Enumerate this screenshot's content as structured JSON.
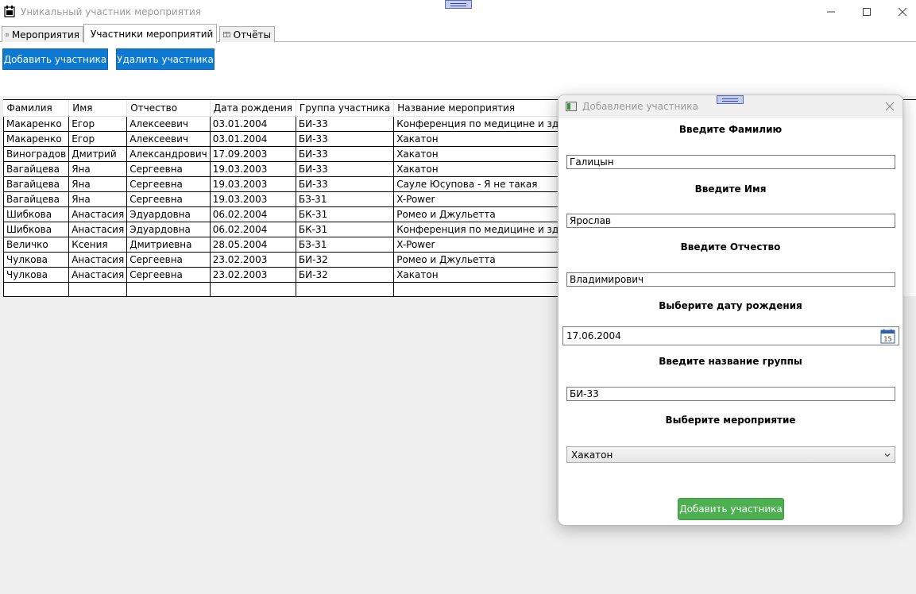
{
  "window": {
    "title": "Уникальный участник мероприятия"
  },
  "tabs": [
    {
      "label": "Мероприятия",
      "icon": "document-icon"
    },
    {
      "label": "Участники мероприятий",
      "icon": "users-icon",
      "active": true
    },
    {
      "label": "Отчёты",
      "icon": "book-icon"
    }
  ],
  "toolbar": {
    "add_label": "Добавить участника",
    "delete_label": "Удалить участника"
  },
  "grid": {
    "columns": [
      "Фамилия",
      "Имя",
      "Отчество",
      "Дата рождения",
      "Группа участника",
      "Название мероприятия"
    ],
    "rows": [
      [
        "Макаренко",
        "Егор",
        "Алексеевич",
        "03.01.2004",
        "БИ-33",
        "Конференция по медицине и здавоохранению"
      ],
      [
        "Макаренко",
        "Егор",
        "Алексеевич",
        "03.01.2004",
        "БИ-33",
        "Хакатон"
      ],
      [
        "Виноградов",
        "Дмитрий",
        "Александрович",
        "17.09.2003",
        "БИ-33",
        "Хакатон"
      ],
      [
        "Вагайцева",
        "Яна",
        "Сергеевна",
        "19.03.2003",
        "БИ-33",
        "Хакатон"
      ],
      [
        "Вагайцева",
        "Яна",
        "Сергеевна",
        "19.03.2003",
        "БИ-33",
        "Сауле Юсупова - Я не такая"
      ],
      [
        "Вагайцева",
        "Яна",
        "Сергеевна",
        "19.03.2003",
        "БЗ-31",
        "X-Power"
      ],
      [
        "Шибкова",
        "Анастасия",
        "Эдуардовна",
        "06.02.2004",
        "БК-31",
        "Ромео и  Джульетта"
      ],
      [
        "Шибкова",
        "Анастасия",
        "Эдуардовна",
        "06.02.2004",
        "БК-31",
        "Конференция по медицине и здавоохранению"
      ],
      [
        "Величко",
        "Ксения",
        "Дмитриевна",
        "28.05.2004",
        "БЗ-31",
        "X-Power"
      ],
      [
        "Чулкова",
        "Анастасия",
        "Сергеевна",
        "23.02.2003",
        "БИ-32",
        "Ромео и  Джульетта"
      ],
      [
        "Чулкова",
        "Анастасия",
        "Сергеевна",
        "23.02.2003",
        "БИ-32",
        "Хакатон"
      ]
    ]
  },
  "dialog": {
    "title": "Добавление участника",
    "surname_label": "Введите Фамилию",
    "surname_value": "Галицын",
    "name_label": "Введите Имя",
    "name_value": "Ярослав",
    "patronymic_label": "Введите Отчество",
    "patronymic_value": "Владимирович",
    "birthdate_label": "Выберите дату рождения",
    "birthdate_value": "17.06.2004",
    "calendar_day": "15",
    "group_label": "Введите название группы",
    "group_value": "БИ-33",
    "event_label": "Выберите мероприятие",
    "event_value": "Хакатон",
    "submit_label": "Добавить участника"
  },
  "colors": {
    "primary_button": "#0d79d1",
    "success_button": "#4caf50"
  }
}
